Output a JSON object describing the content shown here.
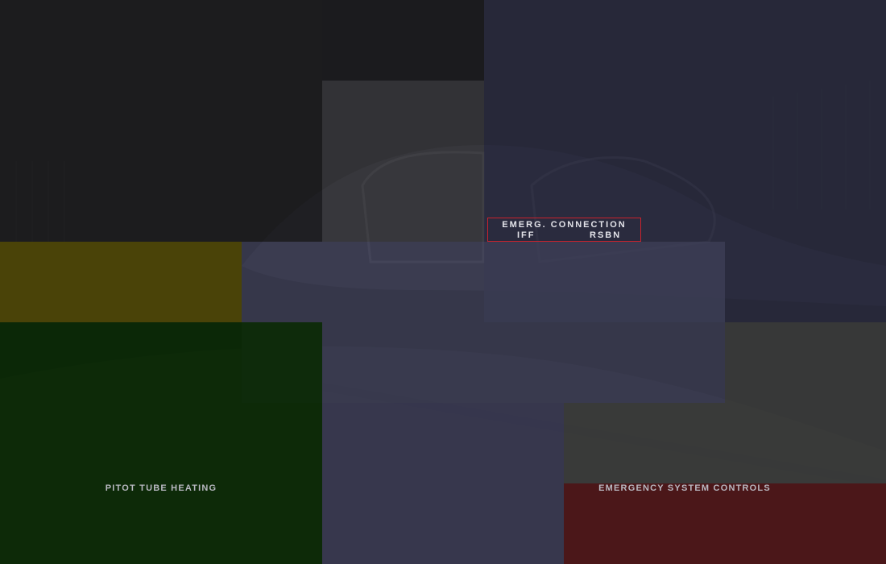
{
  "panel": {
    "highlight": {
      "title": "EMERG. CONNECTION",
      "left": "IFF",
      "right": "RSBN",
      "border_color": "#c9222d"
    },
    "zones": {
      "pitot_tube_heating": "PITOT TUBE HEATING",
      "emergency_system_controls": "EMERGENCY SYSTEM CONTROLS"
    },
    "colors": {
      "dark": "#1c1c1e",
      "gray": "#353438",
      "navy": "#2a2b40",
      "slate": "#3d3e55",
      "olive": "#4a4200",
      "green": "#0a2a04",
      "charcoal": "#3a3b3a",
      "red": "#4e1618"
    }
  }
}
